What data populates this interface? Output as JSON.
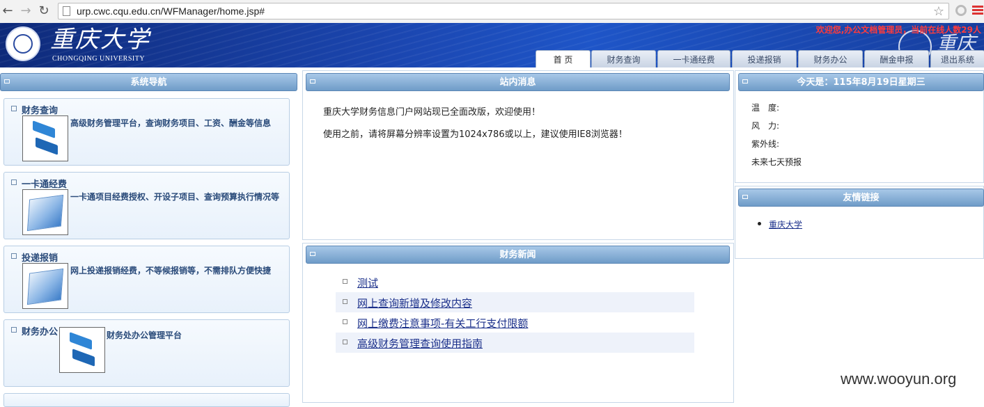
{
  "browser": {
    "url": "urp.cwc.cqu.edu.cn/WFManager/home.jsp#"
  },
  "header": {
    "logo_cn": "重庆大学",
    "logo_en": "CHONGQING UNIVERSITY",
    "welcome": "欢迎您,办公文档管理员，当前在线人数29人",
    "tabs": [
      "首 页",
      "财务查询",
      "一卡通经费",
      "投递报销",
      "财务办公",
      "酬金申报",
      "退出系统"
    ]
  },
  "sidebar": {
    "title": "系统导航",
    "items": [
      {
        "title": "财务查询",
        "desc": "高级财务管理平台，查询财务项目、工资、酬金等信息",
        "icon": "arrows-icon"
      },
      {
        "title": "一卡通经费",
        "desc": "一卡通项目经费授权、开设子项目、查询预算执行情况等",
        "icon": "card-icon"
      },
      {
        "title": "投递报销",
        "desc": "网上投递报销经费，不等候报销等，不需排队方便快捷",
        "icon": "card-icon"
      },
      {
        "title": "财务办公",
        "desc": "财务处办公管理平台",
        "icon": "arrows-icon"
      }
    ]
  },
  "messages": {
    "title": "站内消息",
    "lines": [
      "重庆大学财务信息门户网站现已全面改版，欢迎使用！",
      "使用之前，请将屏幕分辨率设置为1024x786或以上，建议使用IE8浏览器！"
    ]
  },
  "news": {
    "title": "财务新闻",
    "items": [
      "测试",
      "网上查询新增及修改内容",
      "网上缴费注意事项-有关工行支付限额",
      "高级财务管理查询使用指南"
    ]
  },
  "weather": {
    "title": "今天是：115年8月19日星期三",
    "temp_label": "温　度:",
    "wind_label": "风　力:",
    "uv_label": "紫外线:",
    "forecast_label": "未来七天预报"
  },
  "links": {
    "title": "友情链接",
    "items": [
      "重庆大学"
    ]
  },
  "watermark": "www.wooyun.org"
}
